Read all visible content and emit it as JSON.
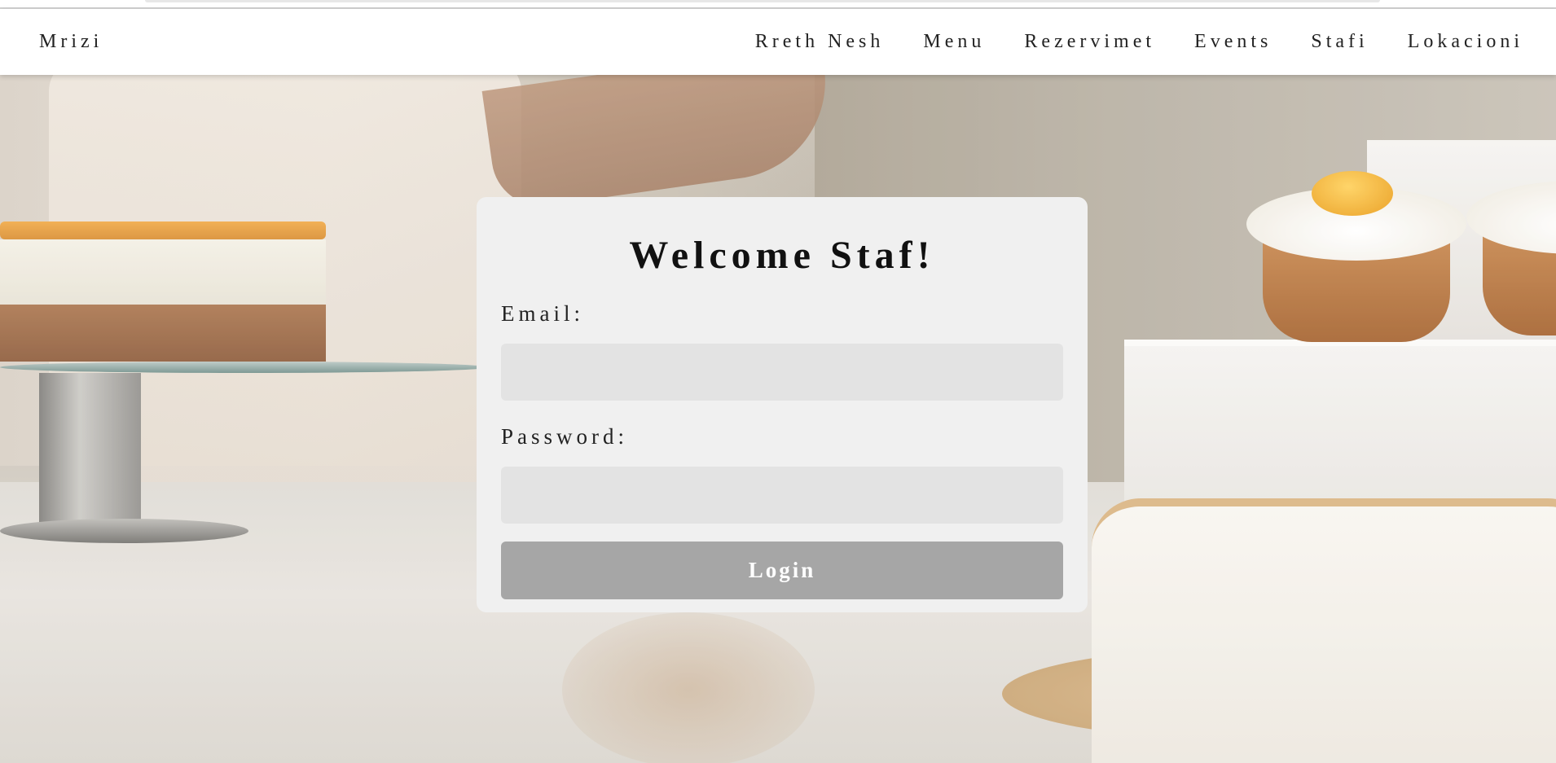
{
  "nav": {
    "brand": "Mrizi",
    "links": [
      "Rreth Nesh",
      "Menu",
      "Rezervimet",
      "Events",
      "Stafi",
      "Lokacioni"
    ]
  },
  "login": {
    "title": "Welcome Staf!",
    "email_label": "Email:",
    "email_value": "",
    "password_label": "Password:",
    "password_value": "",
    "button_label": "Login"
  },
  "colors": {
    "navbar_bg": "#ffffff",
    "card_bg": "#f0f0f0",
    "input_bg": "#e3e3e3",
    "button_bg": "#a6a6a6",
    "button_text": "#ffffff"
  }
}
